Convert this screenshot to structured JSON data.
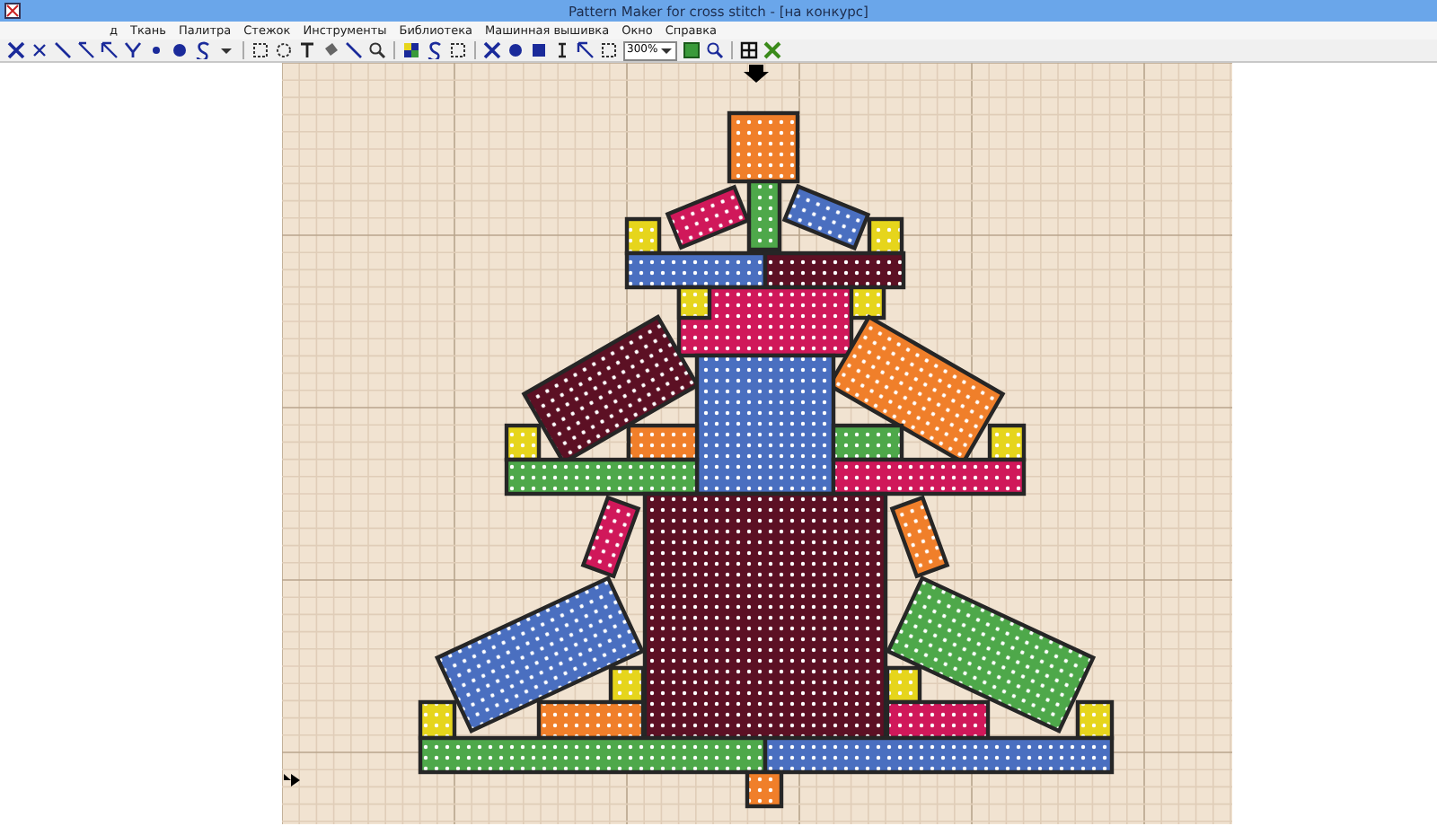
{
  "window": {
    "title": "Pattern Maker for cross stitch - [на конкурс]"
  },
  "menu": [
    "д",
    "Ткань",
    "Палитра",
    "Стежок",
    "Инструменты",
    "Библиотека",
    "Машинная вышивка",
    "Окно",
    "Справка"
  ],
  "toolbar": {
    "zoom": "300%"
  }
}
